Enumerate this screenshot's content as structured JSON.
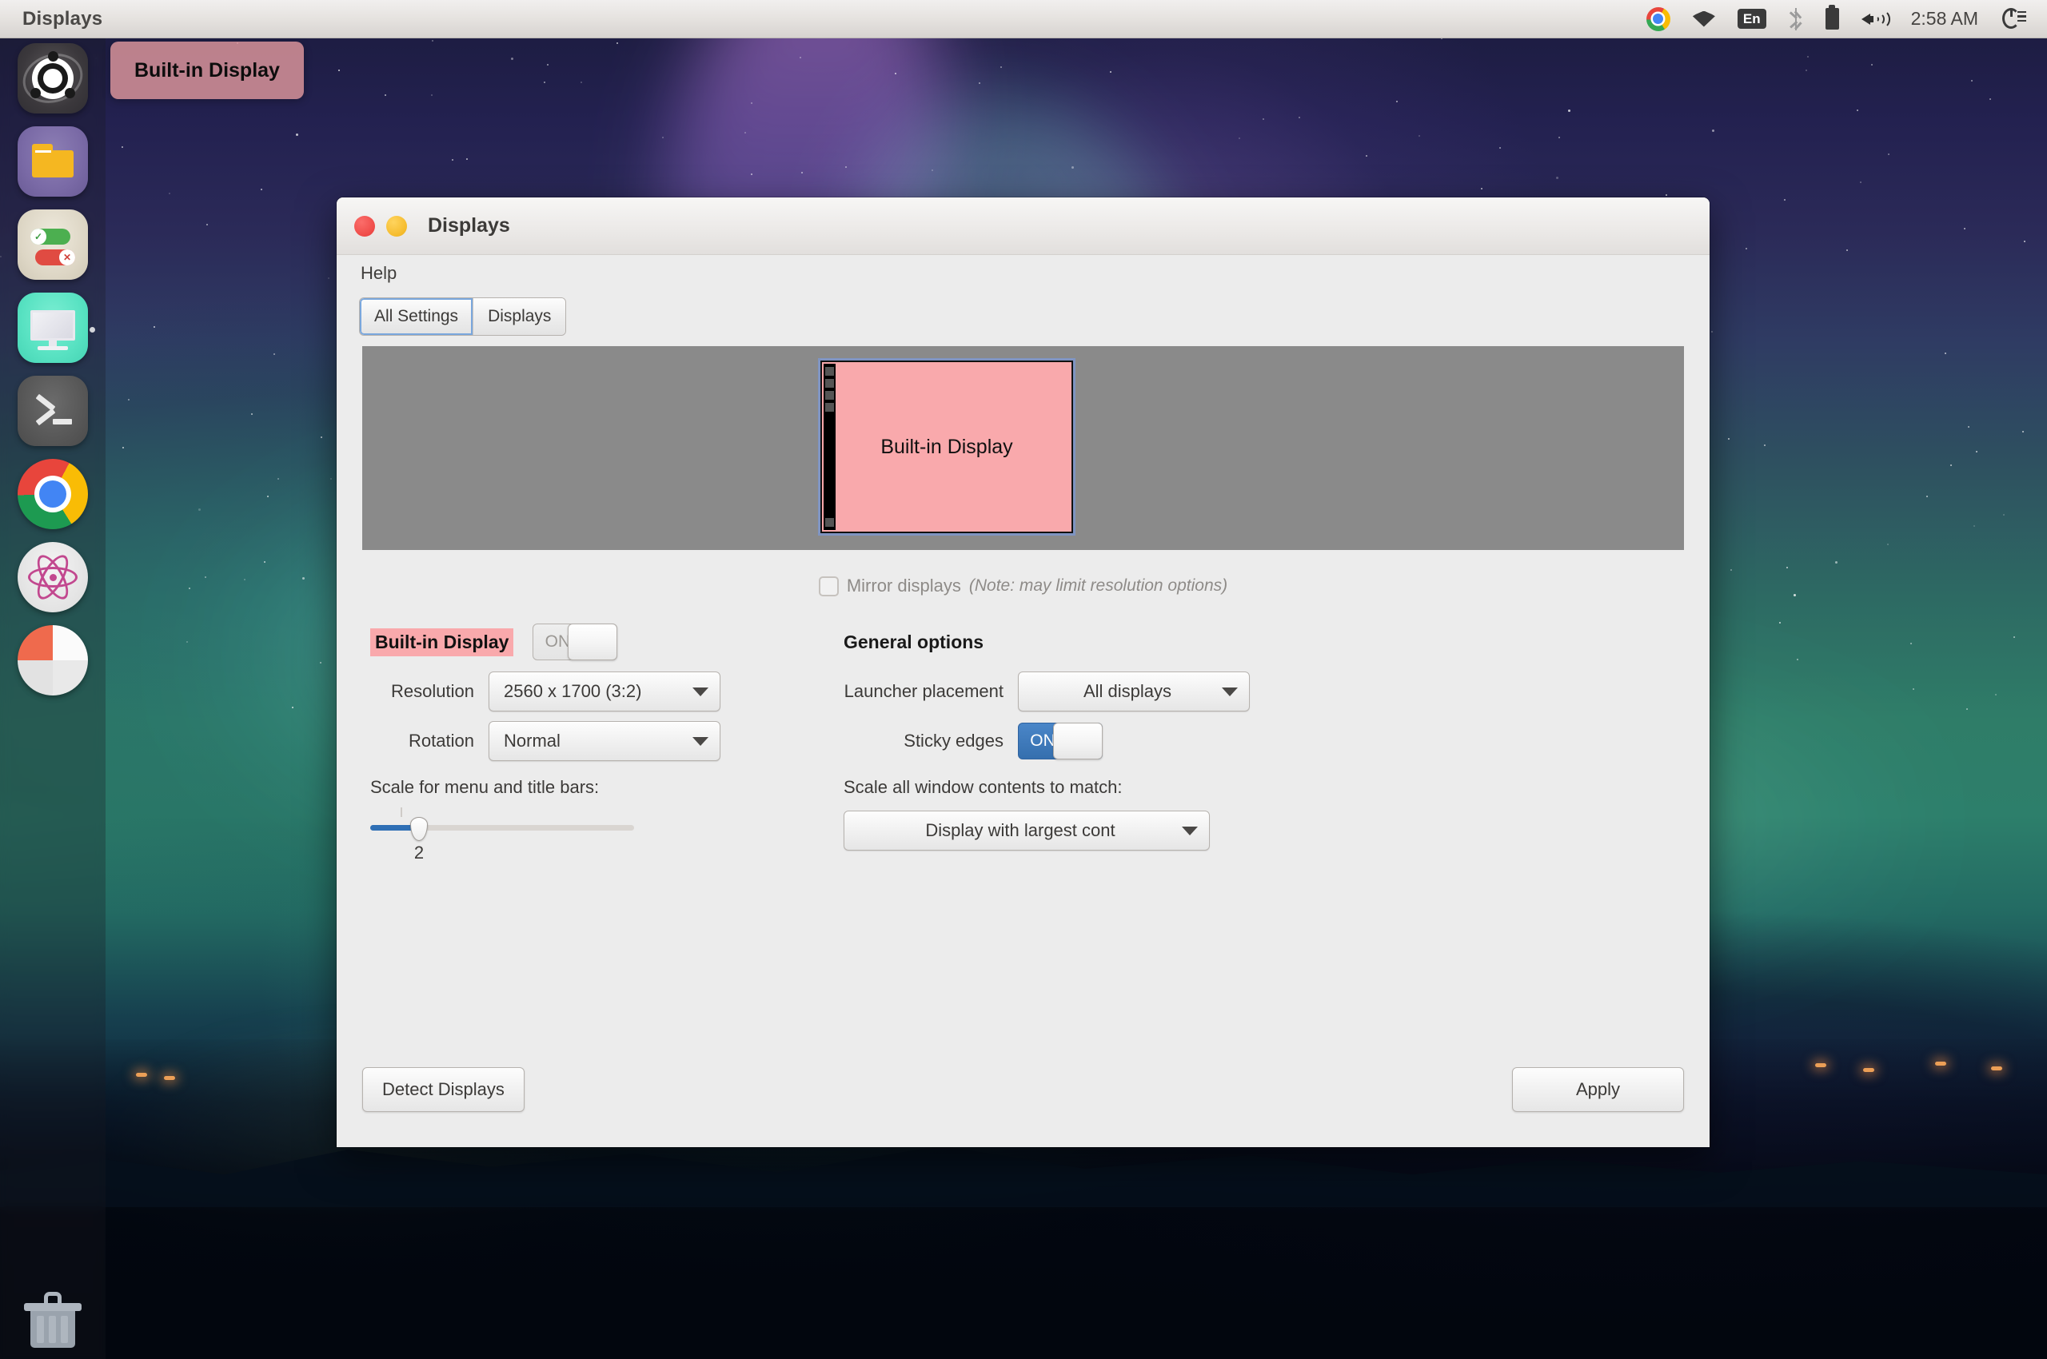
{
  "panel": {
    "title": "Displays",
    "clock": "2:58 AM",
    "tray": [
      {
        "name": "chrome-icon",
        "label": "Chrome"
      },
      {
        "name": "wifi-icon",
        "label": "Wi-Fi"
      },
      {
        "name": "keyboard-layout-icon",
        "label": "En"
      },
      {
        "name": "bluetooth-icon",
        "label": "Bluetooth"
      },
      {
        "name": "battery-icon",
        "label": "Battery"
      },
      {
        "name": "volume-icon",
        "label": "Volume"
      },
      {
        "name": "session-menu-icon",
        "label": "Session"
      }
    ]
  },
  "desktop": {
    "tooltip": "Built-in Display"
  },
  "launcher": {
    "items": [
      {
        "name": "ubuntu-dash-icon",
        "label": "Dash home"
      },
      {
        "name": "files-icon",
        "label": "Files"
      },
      {
        "name": "settings-icon",
        "label": "System Settings"
      },
      {
        "name": "displays-icon",
        "label": "Displays"
      },
      {
        "name": "terminal-icon",
        "label": "Terminal"
      },
      {
        "name": "chrome-icon",
        "label": "Google Chrome"
      },
      {
        "name": "atom-icon",
        "label": "Atom"
      },
      {
        "name": "workspace-switcher-icon",
        "label": "Workspace Switcher"
      }
    ],
    "trash": "Trash"
  },
  "window": {
    "title": "Displays",
    "menu": [
      "Help"
    ],
    "tabs": [
      {
        "label": "All Settings",
        "focused": true
      },
      {
        "label": "Displays",
        "focused": false
      }
    ],
    "preview": {
      "monitor_label": "Built-in Display"
    },
    "mirror": {
      "label": "Mirror displays",
      "note": "(Note: may limit resolution options)",
      "checked": false
    },
    "display_section": {
      "name": "Built-in Display",
      "toggle_label": "ON",
      "toggle_state": "on",
      "toggle_enabled": false,
      "resolution_label": "Resolution",
      "resolution_value": "2560 x 1700 (3:2)",
      "rotation_label": "Rotation",
      "rotation_value": "Normal",
      "scale_label": "Scale for menu and title bars:",
      "scale_value": "2"
    },
    "general_options": {
      "title": "General options",
      "launcher_label": "Launcher placement",
      "launcher_value": "All displays",
      "sticky_label": "Sticky edges",
      "sticky_toggle_label": "ON",
      "sticky_state": "on",
      "scale_all_label": "Scale all window contents to match:",
      "scale_all_value": "Display with largest cont"
    },
    "footer": {
      "detect_label": "Detect Displays",
      "apply_label": "Apply"
    }
  },
  "colors": {
    "accent_blue": "#3a7ebf",
    "display_pink": "#f9a9ac",
    "selection_border": "#7f94c2",
    "panel_bg": "#e6e3e0"
  }
}
